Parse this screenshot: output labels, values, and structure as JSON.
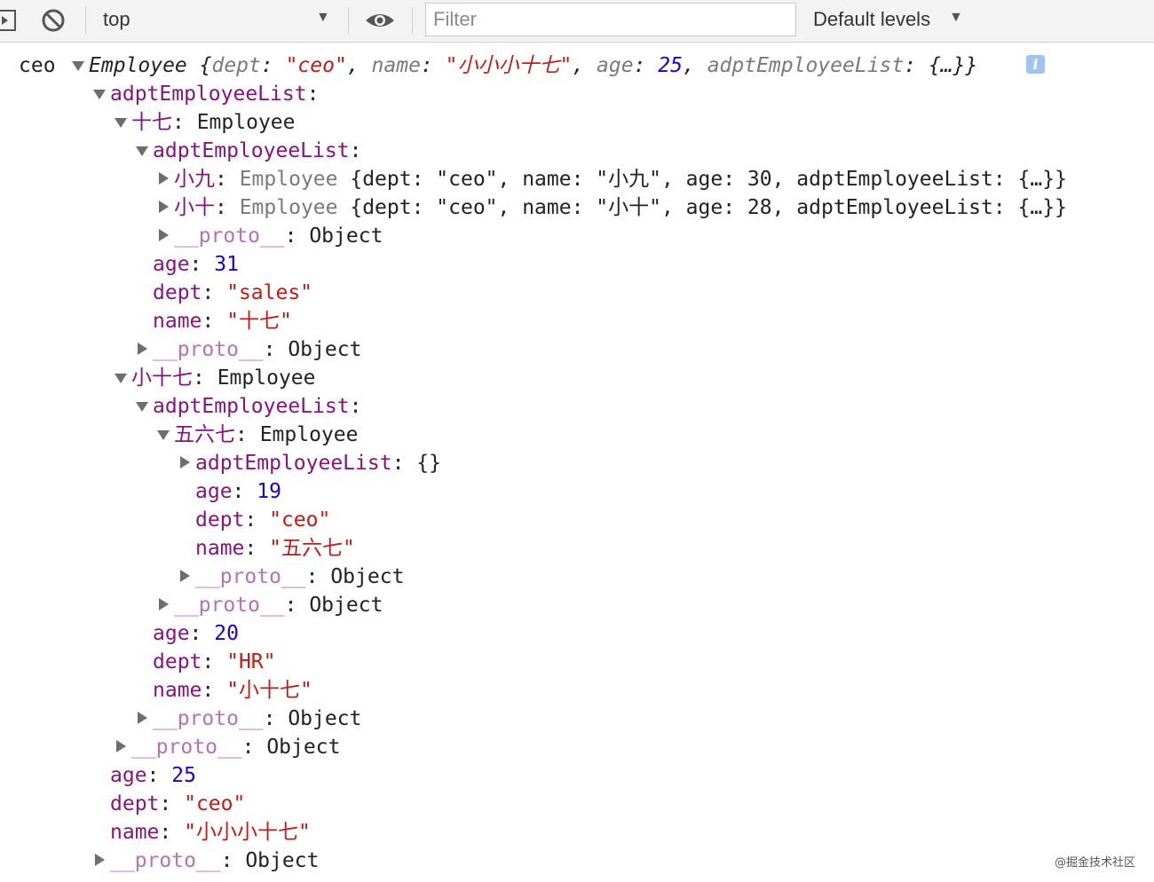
{
  "toolbar": {
    "context": "top",
    "filter_placeholder": "Filter",
    "levels": "Default levels",
    "icons": [
      "sidebar-toggle-icon",
      "clear-console-icon",
      "eye-icon",
      "dropdown-arrow-icon"
    ]
  },
  "console": {
    "source": "ceo",
    "summary": {
      "cls": "Employee",
      "open": " {",
      "k_dept": "dept",
      "v_dept": "\"ceo\"",
      "k_name": "name",
      "v_name": "\"小小小十七\"",
      "k_age": "age",
      "v_age": "25",
      "k_list": "adptEmployeeList",
      "v_list": "{…}}",
      "sep": ": ",
      "comma": ", "
    },
    "labels": {
      "adptEmployeeList": "adptEmployeeList",
      "proto": "__proto__",
      "object": "Object",
      "employee": "Employee",
      "age": "age",
      "dept": "dept",
      "name": "name",
      "empty_obj": "{}",
      "colon": ": ",
      "colon_only": ":"
    },
    "nodes": {
      "shiqi_key": "十七",
      "xiaojiu_key": "小九",
      "xiaojiu_value": "{dept: \"ceo\", name: \"小九\", age: 30, adptEmployeeList: {…}}",
      "xiaoshi_key": "小十",
      "xiaoshi_value": "{dept: \"ceo\", name: \"小十\", age: 28, adptEmployeeList: {…}}",
      "shiqi_age": "31",
      "shiqi_dept": "\"sales\"",
      "shiqi_name": "\"十七\"",
      "xiaoshiqi_key": "小十七",
      "wuliuqi_key": "五六七",
      "wuliuqi_age": "19",
      "wuliuqi_dept": "\"ceo\"",
      "wuliuqi_name": "\"五六七\"",
      "xiaoshiqi_age": "20",
      "xiaoshiqi_dept": "\"HR\"",
      "xiaoshiqi_name": "\"小十七\"",
      "root_age": "25",
      "root_dept": "\"ceo\"",
      "root_name": "\"小小小十七\""
    }
  },
  "watermark": "@掘金技术社区",
  "colors": {
    "key": "#881280",
    "proto_key": "#b871b6",
    "string": "#c41a16",
    "number": "#1c00cf",
    "info_badge": "#9fc4ee"
  }
}
